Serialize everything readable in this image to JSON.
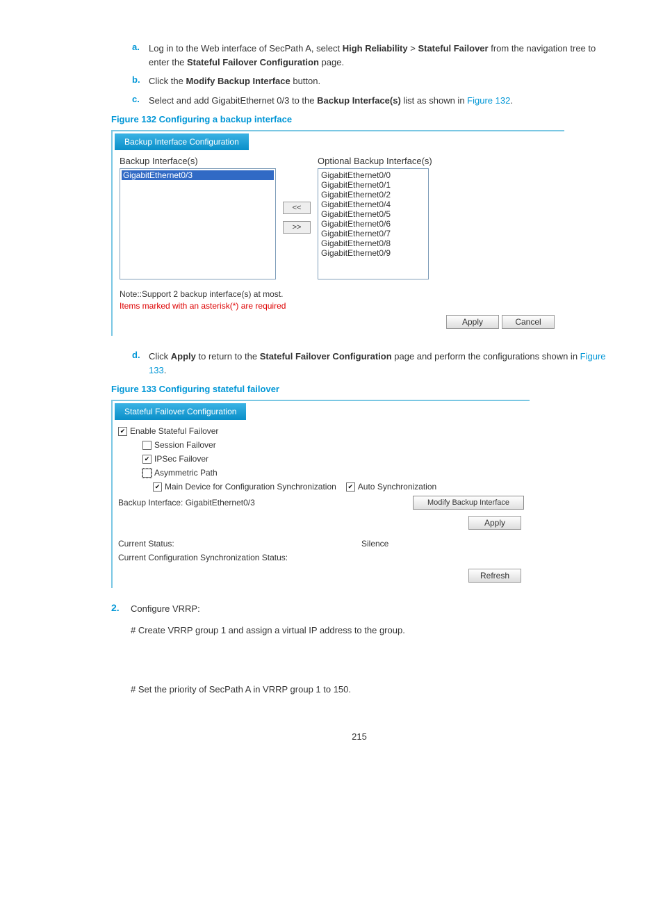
{
  "steps1": {
    "a": {
      "marker": "a.",
      "pre": "Log in to the Web interface of SecPath A, select ",
      "b1": "High Reliability",
      "sep": " > ",
      "b2": "Stateful Failover",
      "post1": " from the navigation tree to enter the ",
      "b3": "Stateful Failover Configuration",
      "post2": " page."
    },
    "b": {
      "marker": "b.",
      "pre": "Click the ",
      "b1": "Modify Backup Interface",
      "post": " button."
    },
    "c": {
      "marker": "c.",
      "pre": "Select and add GigabitEthernet 0/3 to the ",
      "b1": "Backup Interface(s)",
      "post": " list as shown in ",
      "link": "Figure 132",
      "end": "."
    },
    "d": {
      "marker": "d.",
      "pre": "Click ",
      "b1": "Apply",
      "mid": " to return to the ",
      "b2": "Stateful Failover Configuration",
      "post": " page and perform the configurations shown in ",
      "link": "Figure 133",
      "end": "."
    }
  },
  "fig132": {
    "caption": "Figure 132 Configuring a backup interface",
    "tab": "Backup Interface Configuration",
    "left_label": "Backup Interface(s)",
    "left_item": "GigabitEthernet0/3",
    "move_left": "<<",
    "move_right": ">>",
    "right_label": "Optional Backup Interface(s)",
    "right_items": [
      "GigabitEthernet0/0",
      "GigabitEthernet0/1",
      "GigabitEthernet0/2",
      "GigabitEthernet0/4",
      "GigabitEthernet0/5",
      "GigabitEthernet0/6",
      "GigabitEthernet0/7",
      "GigabitEthernet0/8",
      "GigabitEthernet0/9"
    ],
    "note": "Note::Support 2 backup interface(s) at most.",
    "required": "Items marked with an asterisk(*) are required",
    "apply": "Apply",
    "cancel": "Cancel"
  },
  "fig133": {
    "caption": "Figure 133 Configuring stateful failover",
    "tab": "Stateful Failover Configuration",
    "chk_enable": "Enable Stateful Failover",
    "chk_session": "Session Failover",
    "chk_ipsec": "IPSec Failover",
    "chk_asym": "Asymmetric Path",
    "chk_main": "Main Device for Configuration Synchronization",
    "chk_auto": "Auto Synchronization",
    "backup_if_label": "Backup Interface: GigabitEthernet0/3",
    "modify_btn": "Modify Backup Interface",
    "apply": "Apply",
    "status_label": "Current Status:",
    "status_value": "Silence",
    "sync_label": "Current Configuration Synchronization Status:",
    "refresh": "Refresh"
  },
  "step2": {
    "marker": "2.",
    "text": "Configure VRRP:",
    "para1": "# Create VRRP group 1 and assign a virtual IP address to the group.",
    "para2": "# Set the priority of SecPath A in VRRP group 1 to 150."
  },
  "page_num": "215"
}
